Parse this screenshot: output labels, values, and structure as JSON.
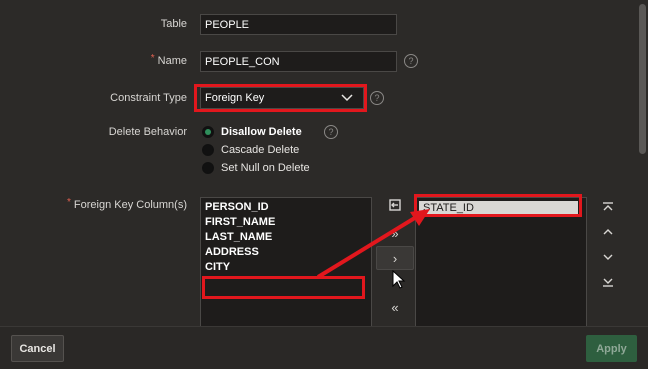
{
  "form": {
    "table_label": "Table",
    "table_value": "PEOPLE",
    "name_label": "Name",
    "name_value": "PEOPLE_CON",
    "constraint_type_label": "Constraint Type",
    "constraint_type_value": "Foreign Key",
    "delete_behavior_label": "Delete Behavior",
    "delete_options": [
      "Disallow Delete",
      "Cascade Delete",
      "Set Null on Delete"
    ],
    "delete_selected": "Disallow Delete",
    "fk_columns_label": "Foreign Key Column(s)",
    "required_marker": "*",
    "help_glyph": "?"
  },
  "shuttle": {
    "available": [
      "PERSON_ID",
      "FIRST_NAME",
      "LAST_NAME",
      "ADDRESS",
      "CITY"
    ],
    "selected": [
      "STATE_ID"
    ],
    "buttons": {
      "reset_icon": "reset-icon",
      "move_all": "»",
      "move": "›",
      "remove_all": "«",
      "top": "top-icon",
      "up": "up-icon",
      "down": "down-icon",
      "bottom": "bottom-icon"
    }
  },
  "footer": {
    "cancel_label": "Cancel",
    "apply_label": "Apply"
  },
  "colors": {
    "background": "#2c2a28",
    "annotation_red": "#e2171d",
    "apply_green": "#2e5f3f",
    "radio_selected": "#2f8f5b"
  }
}
